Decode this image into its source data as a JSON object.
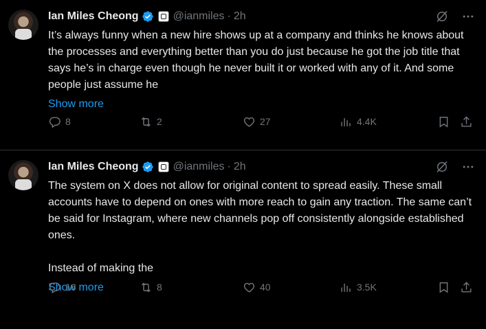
{
  "tweets": [
    {
      "name": "Ian Miles Cheong",
      "handle": "@ianmiles",
      "separator": "·",
      "time": "2h",
      "text": "It’s always funny when a new hire shows up at a company and thinks he knows about the processes and everything better than you do just because he got the job title that says he’s in charge even though he never built it or worked with any of it. And some people just assume he",
      "show_more": "Show more",
      "replies": "8",
      "retweets": "2",
      "likes": "27",
      "views": "4.4K"
    },
    {
      "name": "Ian Miles Cheong",
      "handle": "@ianmiles",
      "separator": "·",
      "time": "2h",
      "text": "The system on X does not allow for original content to spread easily. These small accounts have to depend on ones with more reach to gain any traction. The same can’t be said for Instagram, where new channels pop off consistently alongside established ones.\n\nInstead of making the",
      "show_more": "Show more",
      "replies": "16",
      "retweets": "8",
      "likes": "40",
      "views": "3.5K"
    }
  ],
  "icons": {
    "verified": "verified-badge-icon",
    "affiliate": "affiliate-badge-icon",
    "grok": "grok-icon",
    "more": "more-icon",
    "reply": "reply-icon",
    "retweet": "retweet-icon",
    "like": "like-icon",
    "views": "views-icon",
    "bookmark": "bookmark-icon",
    "share": "share-icon"
  },
  "colors": {
    "accent": "#1d9bf0",
    "muted": "#71767b",
    "text": "#e7e9ea",
    "background": "#000000"
  }
}
